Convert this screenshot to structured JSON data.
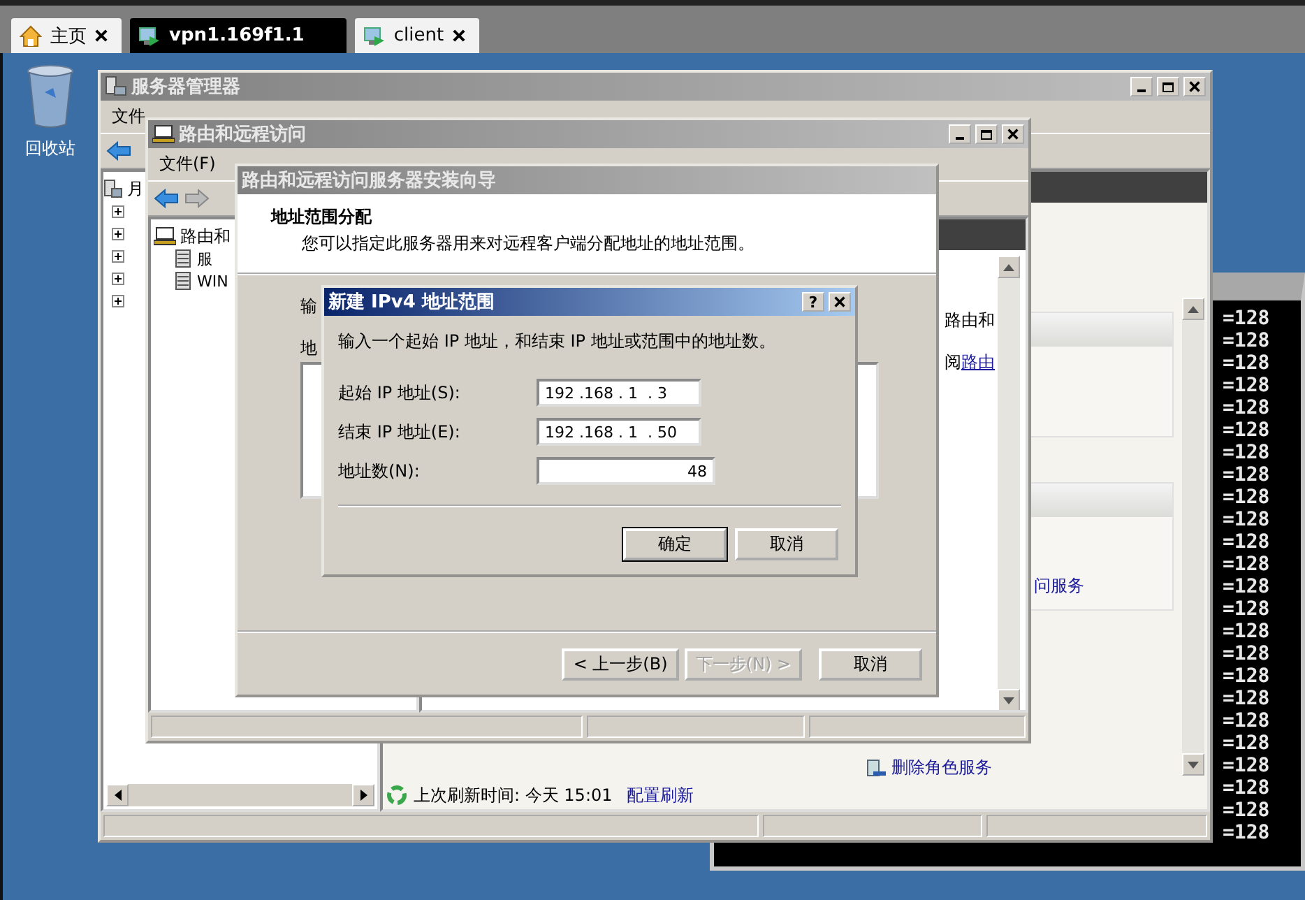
{
  "browser_tabs": [
    {
      "label": "主页",
      "kind": "home",
      "selected": false,
      "closable": true
    },
    {
      "label": "vpn1.169f1.1",
      "kind": "remote",
      "selected": true,
      "closable": false
    },
    {
      "label": "client",
      "kind": "remote",
      "selected": false,
      "closable": true
    }
  ],
  "desktop": {
    "icons": [
      {
        "label": "回收站"
      }
    ]
  },
  "terminal": {
    "lines": [
      "=128",
      "=128",
      "=128",
      "=128",
      "=128",
      "=128",
      "=128",
      "=128",
      "=128",
      "=128",
      "=128",
      "=128",
      "=128",
      "=128",
      "=128",
      "=128",
      "=128",
      "=128",
      "=128",
      "=128",
      "=128",
      "=128",
      "=128",
      "=128"
    ]
  },
  "server_manager": {
    "title": "服务器管理器",
    "menu": [
      "文件"
    ],
    "tree_first_letter": "月",
    "right_pane": {
      "link_fragment": "问服务",
      "task_links": [
        "删除角色服务"
      ],
      "refresh_text": "上次刷新时间: 今天 15:01",
      "refresh_link": "配置刷新"
    }
  },
  "routing_window": {
    "title": "路由和远程访问",
    "menu": [
      "文件(F)"
    ],
    "tree": [
      {
        "label": "路由和",
        "expanded": true,
        "children": [
          {
            "label": "服"
          },
          {
            "label": "WIN"
          }
        ]
      }
    ],
    "right_pane": {
      "text": "路由和",
      "link_prefix": "阅",
      "link": "路由"
    }
  },
  "wizard": {
    "title": "路由和远程访问服务器安装向导",
    "heading": "地址范围分配",
    "subheading": "您可以指定此服务器用来对远程客户端分配地址的地址范围。",
    "body_fragments": [
      "输",
      "地"
    ],
    "buttons": [
      {
        "label": "< 上一步(B)",
        "disabled": false
      },
      {
        "label": "下一步(N) >",
        "disabled": true
      },
      {
        "label": "取消",
        "disabled": false
      }
    ]
  },
  "dialog": {
    "title": "新建 IPv4 地址范围",
    "help": "?",
    "instruction": "输入一个起始 IP 地址，和结束 IP 地址或范围中的地址数。",
    "fields": [
      {
        "label": "起始 IP 地址(S):",
        "kind": "ip",
        "value": "192 .168 . 1  . 3"
      },
      {
        "label": "结束 IP 地址(E):",
        "kind": "ip",
        "value": "192 .168 . 1  . 50"
      },
      {
        "label": "地址数(N):",
        "kind": "number",
        "value": "48"
      }
    ],
    "buttons": [
      {
        "label": "确定",
        "default": true
      },
      {
        "label": "取消",
        "default": false
      }
    ]
  }
}
